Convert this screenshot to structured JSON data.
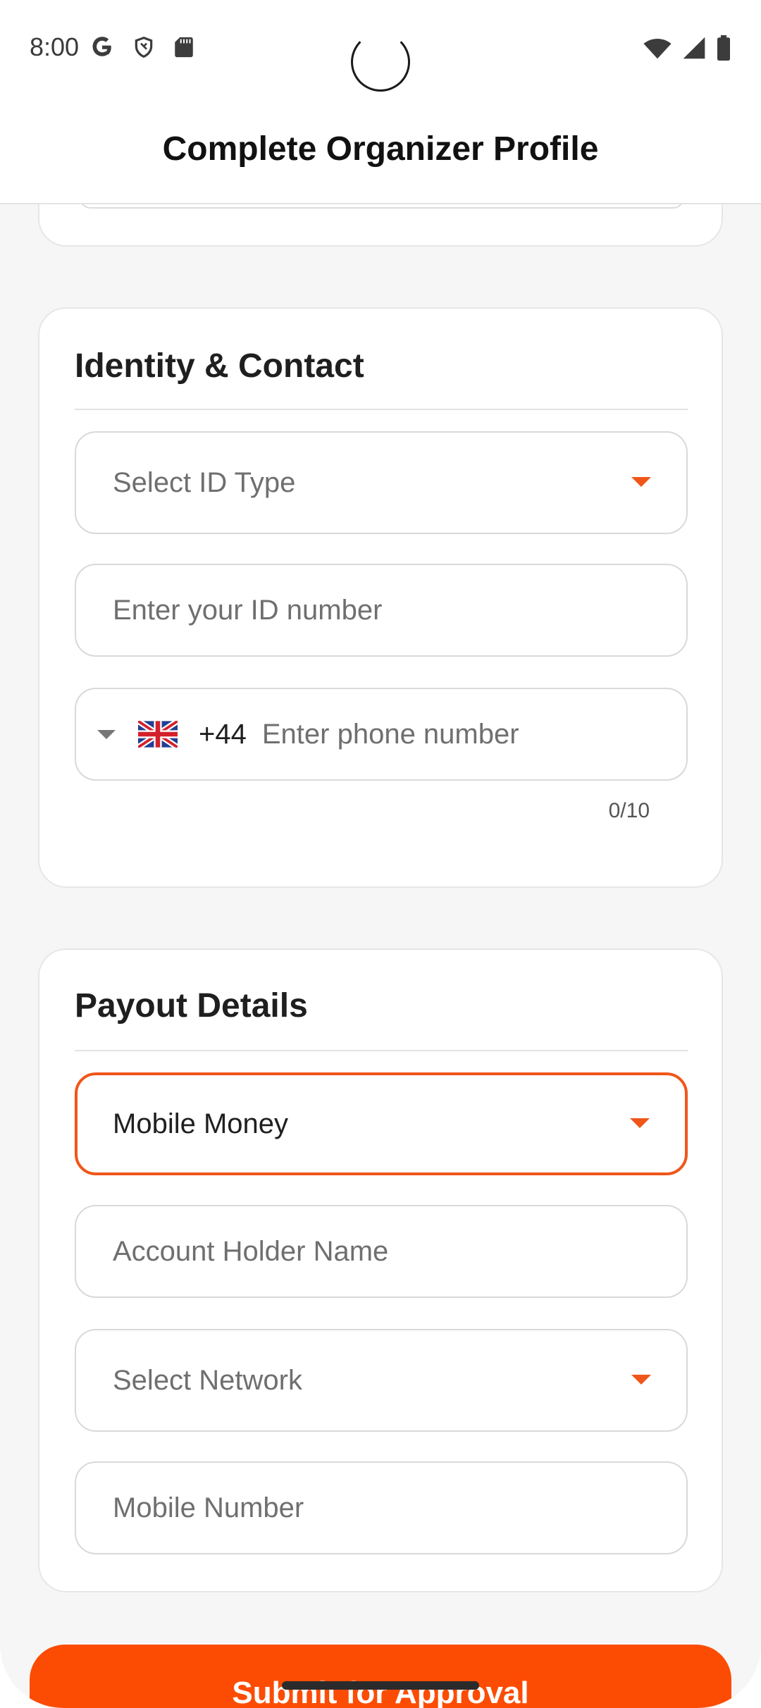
{
  "status_bar": {
    "time": "8:00",
    "left_icons": [
      "google-g-icon",
      "shield-icon",
      "sd-card-icon"
    ],
    "right_icons": [
      "wifi-icon",
      "signal-icon",
      "battery-icon"
    ]
  },
  "app_bar": {
    "title": "Complete Organizer Profile"
  },
  "identity": {
    "heading": "Identity & Contact",
    "id_type_placeholder": "Select ID Type",
    "id_number_placeholder": "Enter your ID number",
    "phone": {
      "flag_icon": "uk-flag-icon",
      "dial_code": "+44",
      "placeholder": "Enter phone number",
      "counter": "0/10"
    }
  },
  "payout": {
    "heading": "Payout Details",
    "method_selected": "Mobile Money",
    "account_holder_placeholder": "Account Holder Name",
    "network_placeholder": "Select Network",
    "mobile_number_placeholder": "Mobile Number"
  },
  "submit": {
    "label": "Submit for Approval"
  },
  "colors": {
    "accent": "#f0561a",
    "button": "#fc4c04",
    "background": "#f6f6f6",
    "card": "#ffffff",
    "border": "#d9d9d9"
  }
}
